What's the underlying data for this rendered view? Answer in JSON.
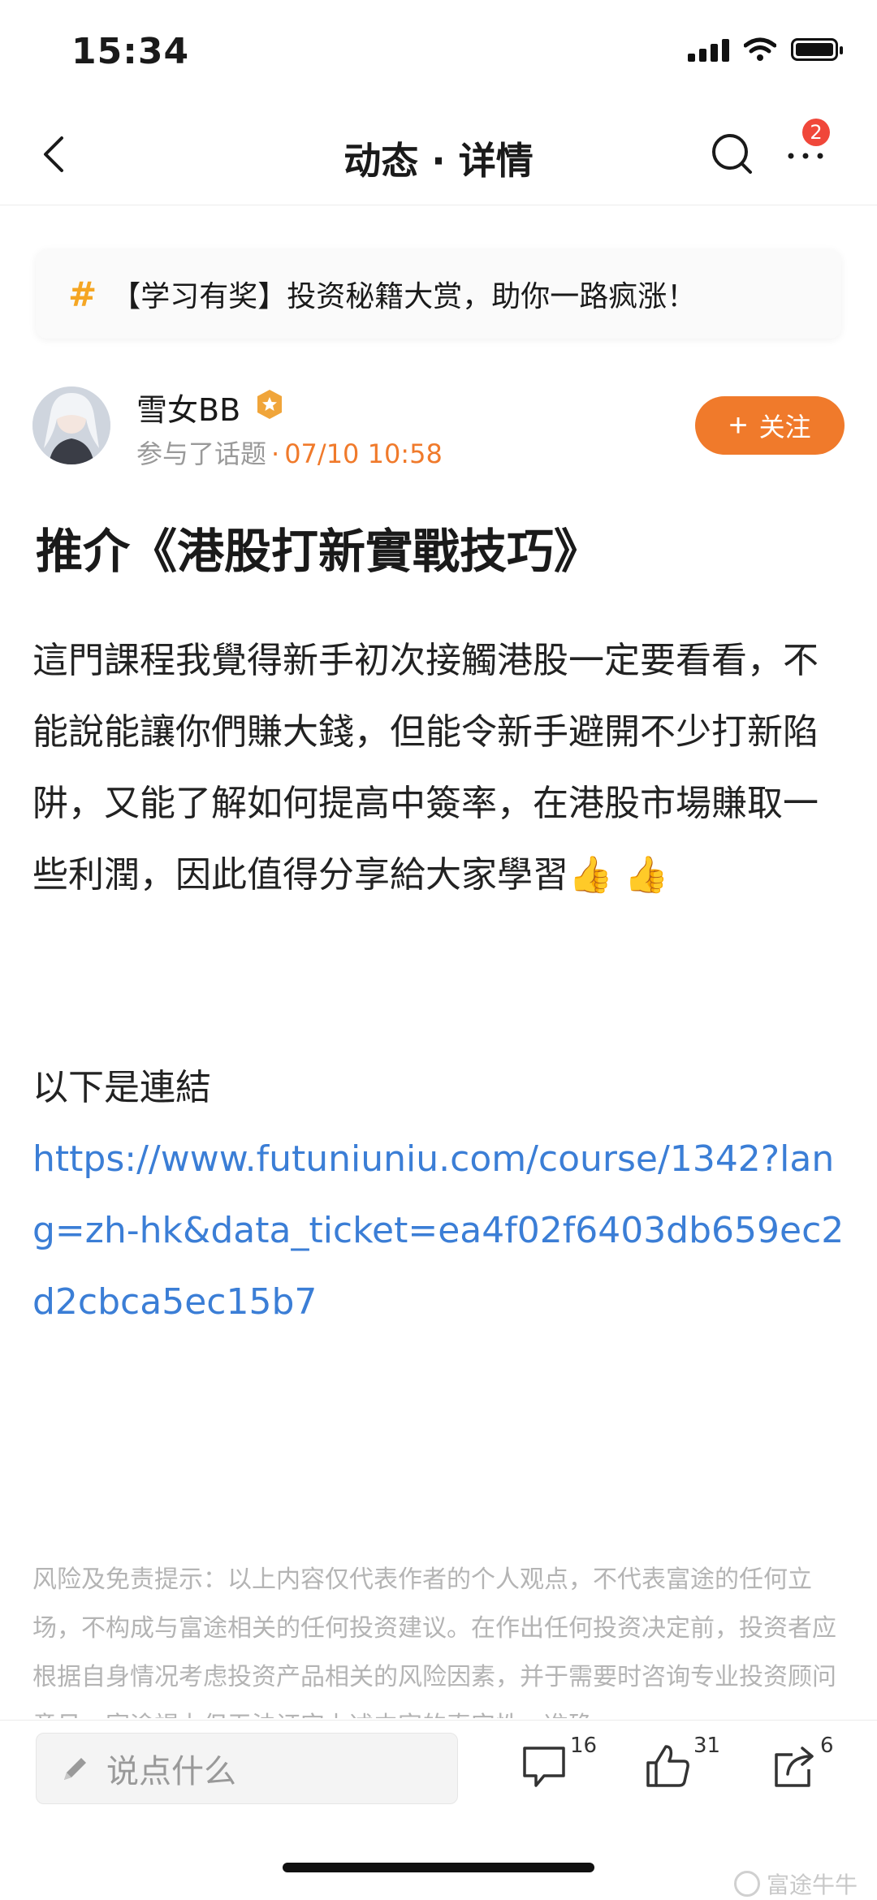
{
  "status_bar": {
    "time": "15:34"
  },
  "nav": {
    "title": "动态 · 详情",
    "badge_count": "2"
  },
  "topic": {
    "hash": "#",
    "text": "【学习有奖】投资秘籍大赏，助你一路疯涨！"
  },
  "author": {
    "name": "雪女BB",
    "meta_prefix": "参与了话题",
    "meta_dot": "·",
    "date": "07/10 10:58",
    "follow_plus": "+",
    "follow_label": "关注"
  },
  "post": {
    "title": "推介《港股打新實戰技巧》",
    "body": "這門課程我覺得新手初次接觸港股一定要看看，不能說能讓你們賺大錢，但能令新手避開不少打新陷阱，又能了解如何提高中簽率，在港股市場賺取一些利潤，因此值得分享給大家學習",
    "thumbs": "👍 👍",
    "link_label": "以下是連結",
    "link": "https://www.futuniuniu.com/course/1342?lang=zh-hk&data_ticket=ea4f02f6403db659ec2d2cbca5ec15b7"
  },
  "disclaimer": "风险及免责提示：以上内容仅代表作者的个人观点，不代表富途的任何立场，不构成与富途相关的任何投资建议。在作出任何投资决定前，投资者应根据自身情况考虑投资产品相关的风险因素，并于需要时咨询专业投资顾问意见。富途竭力但无法证实上述内容的真实性、准确",
  "bottom_bar": {
    "comment_placeholder": "说点什么",
    "comment_count": "16",
    "like_count": "31",
    "share_count": "6"
  },
  "watermark": "富途牛牛"
}
